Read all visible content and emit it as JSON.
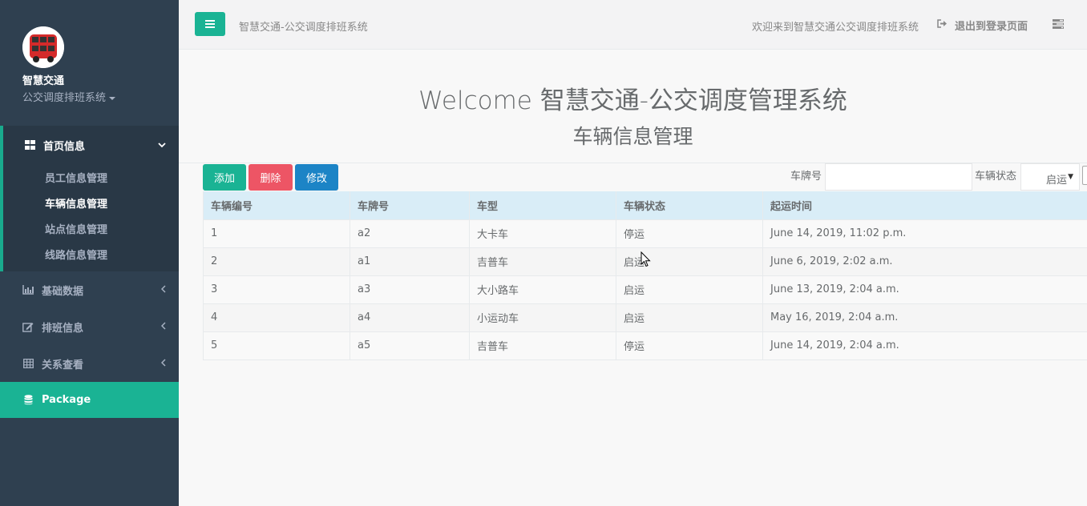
{
  "sidebar": {
    "app_name": "智慧交通",
    "app_subtitle": "公交调度排班系统",
    "nav": {
      "home": {
        "label": "首页信息",
        "icon": "dashboard-icon"
      },
      "sub_items": [
        {
          "label": "员工信息管理"
        },
        {
          "label": "车辆信息管理"
        },
        {
          "label": "站点信息管理"
        },
        {
          "label": "线路信息管理"
        }
      ],
      "basic": {
        "label": "基础数据",
        "icon": "bar-chart-icon"
      },
      "schedule": {
        "label": "排班信息",
        "icon": "edit-icon"
      },
      "relations": {
        "label": "关系查看",
        "icon": "table-icon"
      },
      "package": {
        "label": "Package",
        "icon": "database-icon"
      }
    }
  },
  "topbar": {
    "title": "智慧交通-公交调度排班系统",
    "welcome": "欢迎来到智慧交通公交调度排班系统",
    "logout": "退出到登录页面"
  },
  "hero": {
    "title": "Welcome 智慧交通-公交调度管理系统",
    "subtitle": "车辆信息管理"
  },
  "toolbar": {
    "add": "添加",
    "delete": "删除",
    "edit": "修改",
    "plate_label": "车牌号",
    "plate_value": "",
    "status_label": "车辆状态",
    "status_selected": "启运"
  },
  "table": {
    "headers": [
      "车辆编号",
      "车牌号",
      "车型",
      "车辆状态",
      "起运时间"
    ],
    "rows": [
      [
        "1",
        "a2",
        "大卡车",
        "停运",
        "June 14, 2019, 11:02 p.m."
      ],
      [
        "2",
        "a1",
        "吉普车",
        "启运",
        "June 6, 2019, 2:02 a.m."
      ],
      [
        "3",
        "a3",
        "大小路车",
        "启运",
        "June 13, 2019, 2:04 a.m."
      ],
      [
        "4",
        "a4",
        "小运动车",
        "启运",
        "May 16, 2019, 2:04 a.m."
      ],
      [
        "5",
        "a5",
        "吉普车",
        "停运",
        "June 14, 2019, 2:04 a.m."
      ]
    ]
  },
  "colors": {
    "sidebar_bg": "#2f4050",
    "accent": "#1ab394",
    "danger": "#ed5565",
    "primary": "#1c84c6",
    "table_header_bg": "#d9edf7"
  }
}
